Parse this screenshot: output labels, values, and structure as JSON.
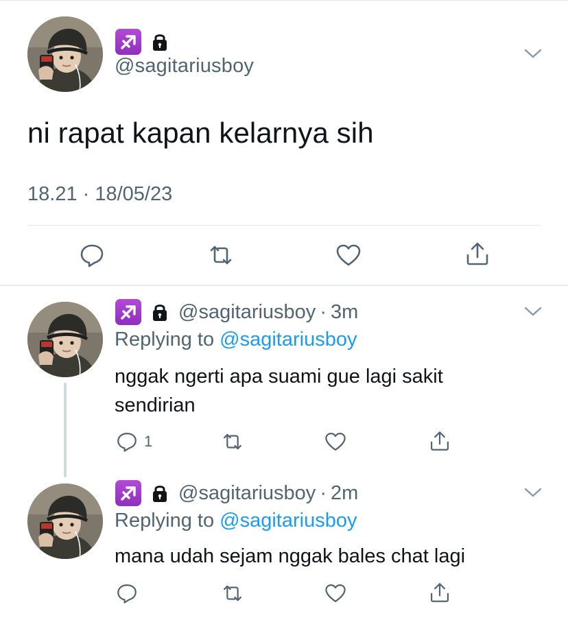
{
  "main": {
    "handle": "@sagitariusboy",
    "text": "ni rapat kapan kelarnya sih",
    "timestamp": "18.21 · 18/05/23",
    "icons": [
      "sagittarius-emoji",
      "lock-icon",
      "chevron-down-icon",
      "reply-icon",
      "retweet-icon",
      "like-icon",
      "share-icon"
    ]
  },
  "replies": [
    {
      "handle": "@sagitariusboy",
      "dot": "·",
      "time": "3m",
      "replying_prefix": "Replying to",
      "replying_to": "@sagitariusboy",
      "text": "nggak ngerti apa suami gue lagi sakit sendirian",
      "reply_count": "1"
    },
    {
      "handle": "@sagitariusboy",
      "dot": "·",
      "time": "2m",
      "replying_prefix": "Replying to",
      "replying_to": "@sagitariusboy",
      "text": "mana udah sejam nggak bales chat lagi",
      "reply_count": ""
    }
  ],
  "colors": {
    "text": "#0f1419",
    "secondary": "#536471",
    "link": "#1d9bf0",
    "emoji_bg": "#9b36c9",
    "divider": "#e1e8ed"
  }
}
